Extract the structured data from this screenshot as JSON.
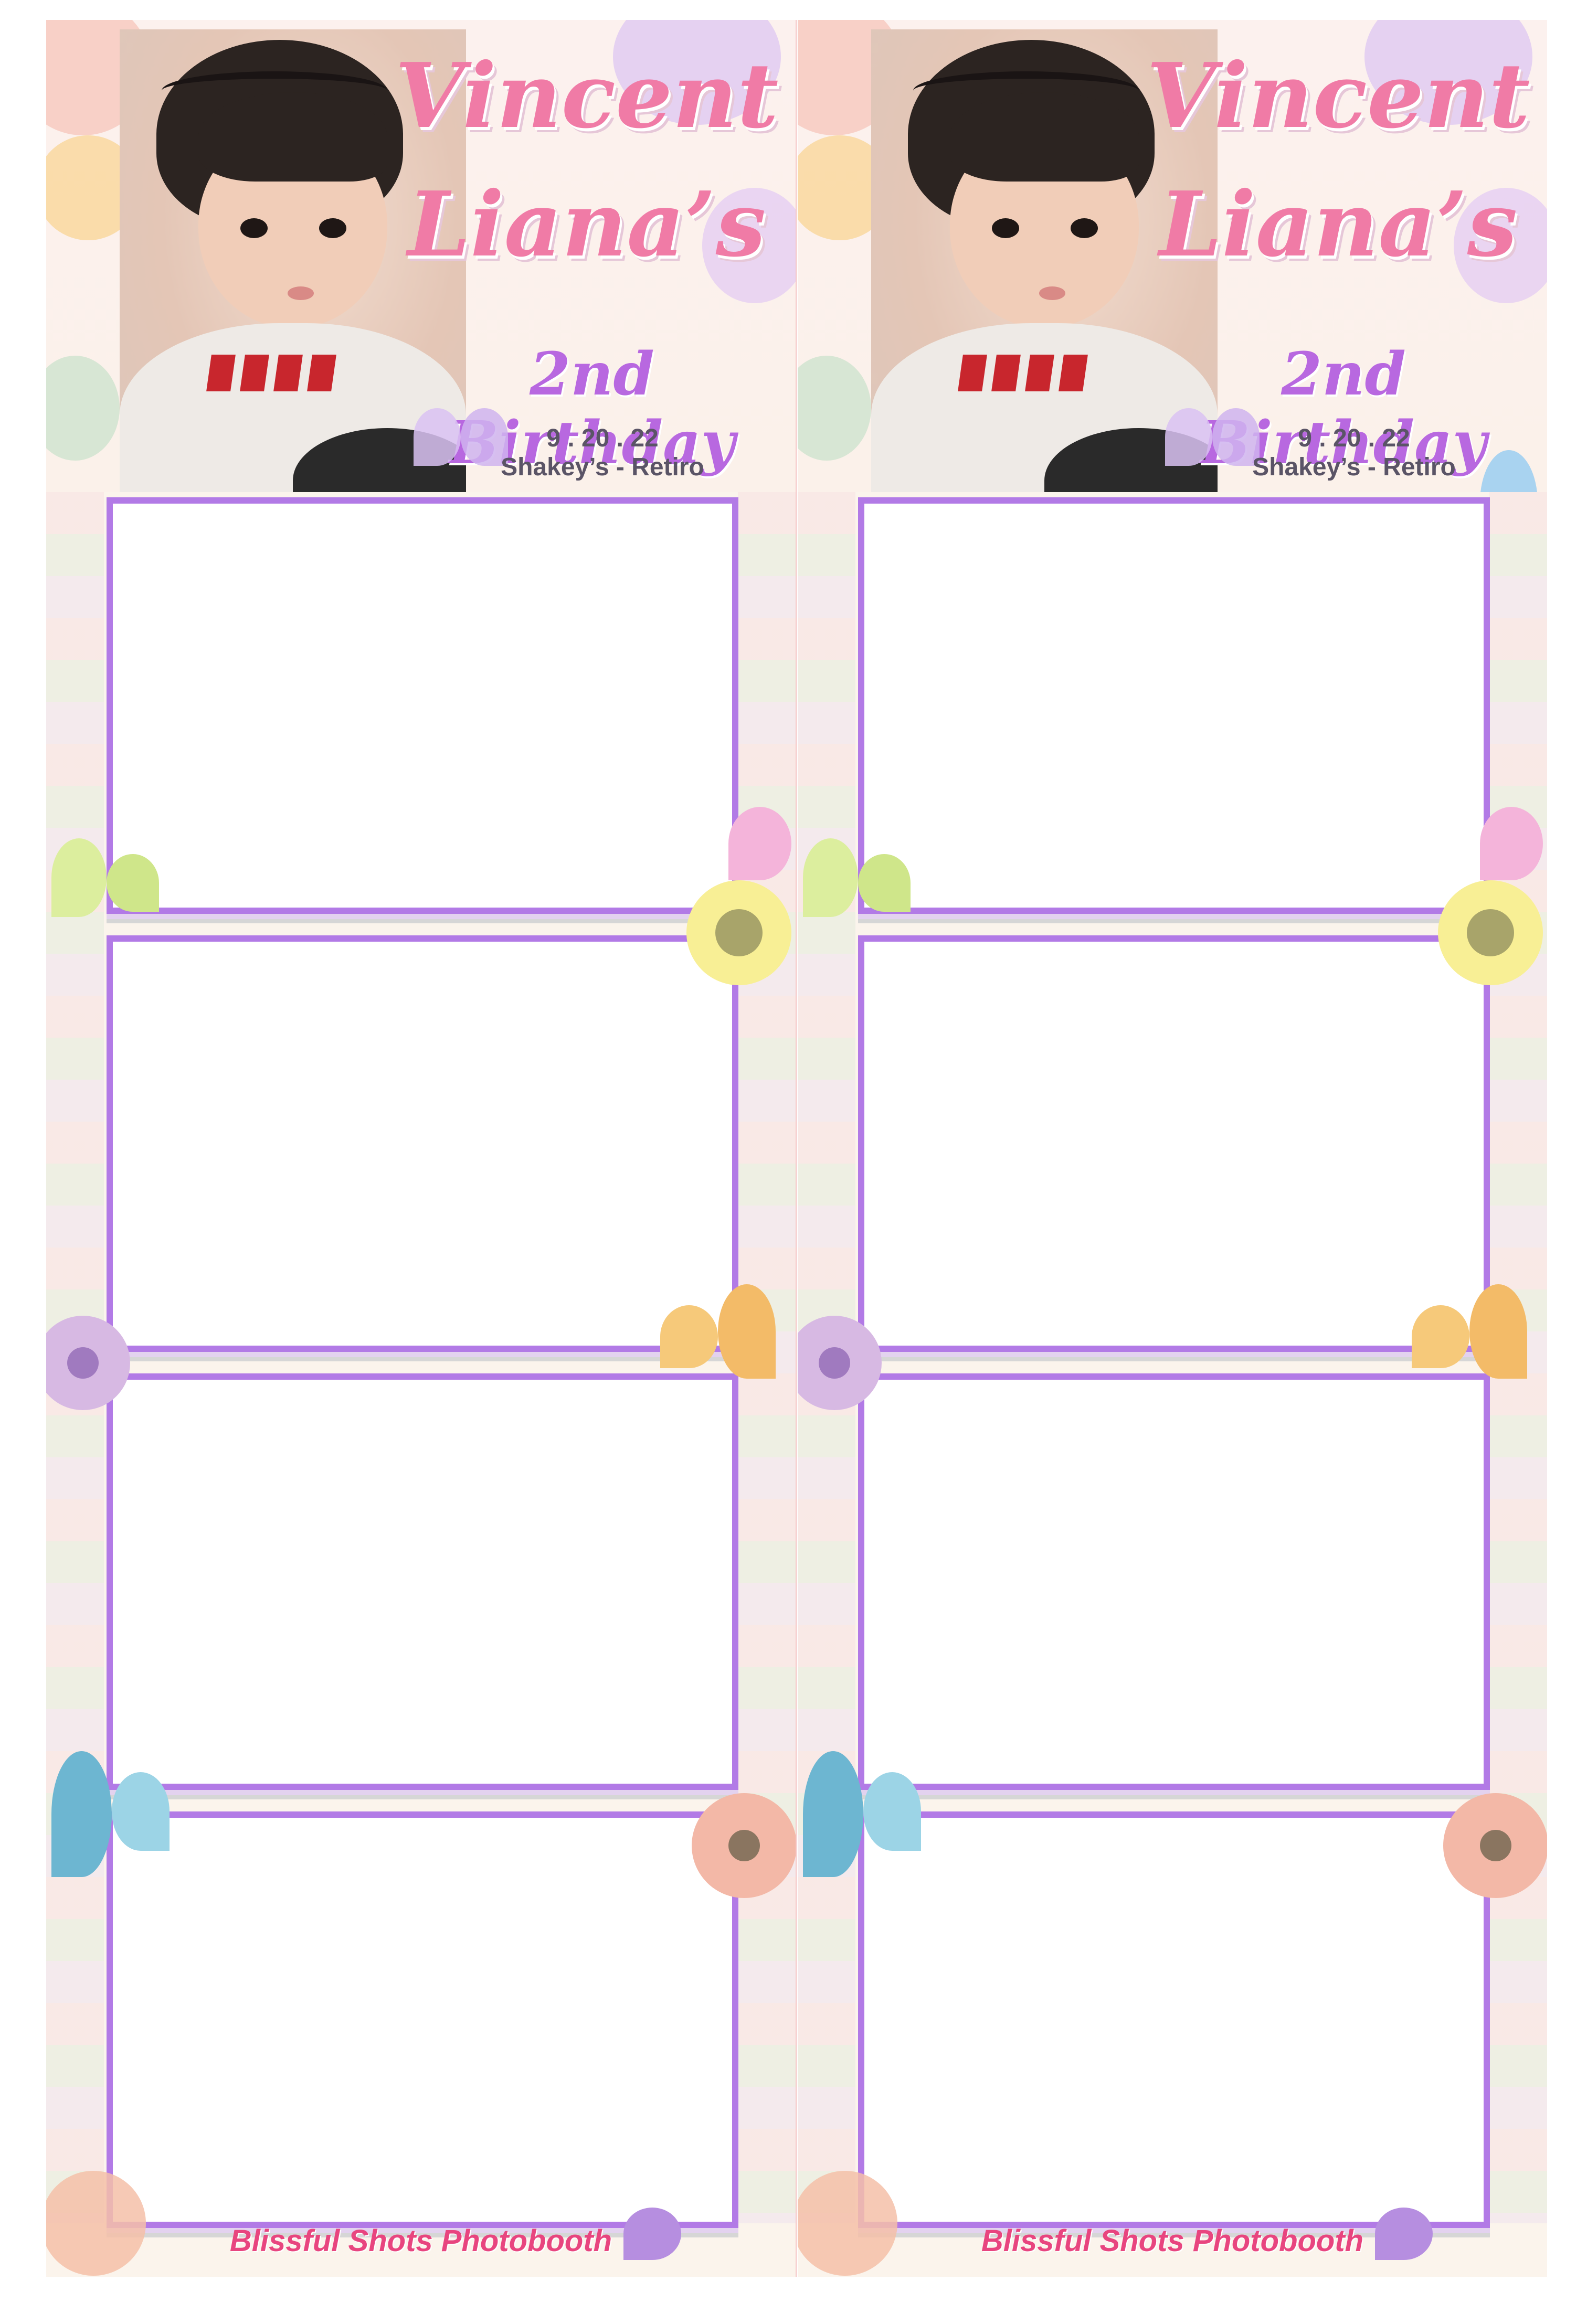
{
  "strips": [
    {
      "title_line1": "Vincent",
      "title_line2": "Liana’s",
      "subtitle": "2nd Birthday",
      "date": "9 . 20 . 22",
      "venue": "Shakey’s - Retiro",
      "footer": "Blissful Shots Photobooth"
    },
    {
      "title_line1": "Vincent",
      "title_line2": "Liana’s",
      "subtitle": "2nd Birthday",
      "date": "9 . 20 . 22",
      "venue": "Shakey’s - Retiro",
      "footer": "Blissful Shots Photobooth"
    }
  ],
  "colors": {
    "title": "#f07ba6",
    "subtitle": "#b868e0",
    "frame_border": "#b27ae6",
    "footer": "#e8457f",
    "background": "#fbf4ec"
  },
  "icons": [
    "butterfly-icon",
    "flower-icon",
    "baby-photo"
  ]
}
